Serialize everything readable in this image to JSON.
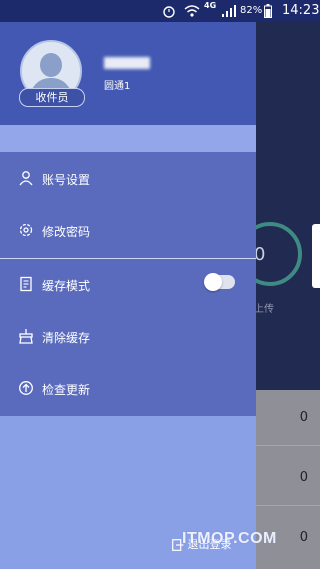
{
  "status_bar": {
    "network": "4G",
    "battery": "82%",
    "time": "14:23"
  },
  "drawer": {
    "user": {
      "role_badge": "收件员",
      "description": "圆通1"
    },
    "menu": [
      {
        "label": "账号设置",
        "icon": "person-icon"
      },
      {
        "label": "修改密码",
        "icon": "gear-icon"
      },
      {
        "label": "缓存模式",
        "icon": "document-icon",
        "toggle_on": false
      },
      {
        "label": "清除缓存",
        "icon": "broom-icon"
      },
      {
        "label": "检查更新",
        "icon": "up-arrow-circle-icon"
      }
    ],
    "logout_label": "退出登录"
  },
  "background": {
    "gauge_value": "0",
    "upload_text": "上传",
    "counts": [
      "0",
      "0",
      "0"
    ]
  },
  "watermark": "ITMOP.COM"
}
